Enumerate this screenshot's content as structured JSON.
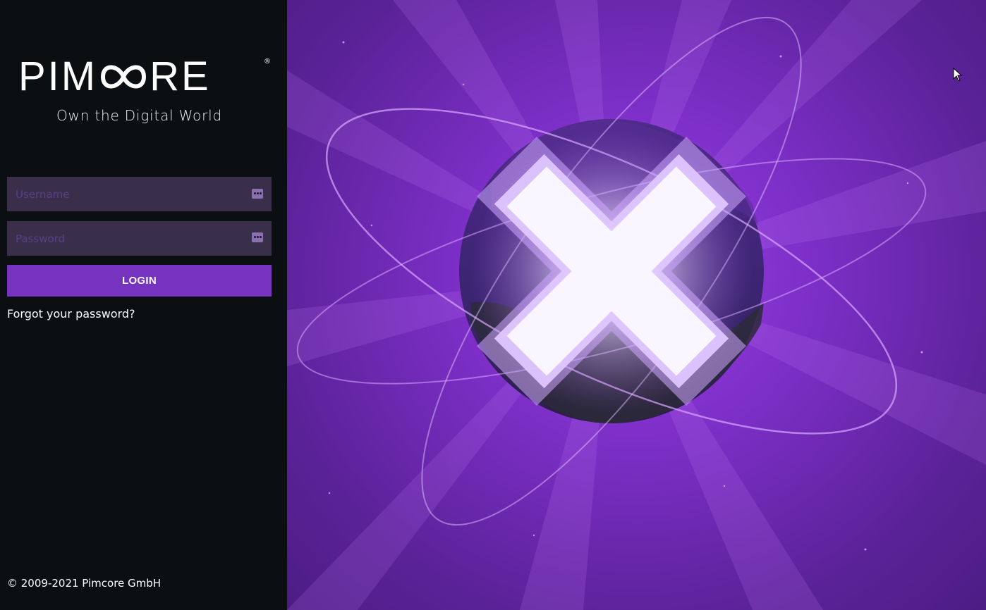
{
  "brand": {
    "logo_text_left": "PIM",
    "logo_text_right": "RE",
    "reg_mark": "®",
    "tagline": "Own the Digital World"
  },
  "form": {
    "username_placeholder": "Username",
    "password_placeholder": "Password",
    "login_label": "LOGIN",
    "forgot_label": "Forgot your password?"
  },
  "footer": {
    "copyright": "© 2009-2021 Pimcore GmbH"
  },
  "colors": {
    "panel_bg": "#0b0f12",
    "field_bg": "#3a2f4a",
    "accent": "#7533c0",
    "hero_purple": "#7d2fc8"
  },
  "icons": {
    "field_icon": "password-manager-key-icon",
    "hero": "pimcore-x-planet-illustration"
  }
}
